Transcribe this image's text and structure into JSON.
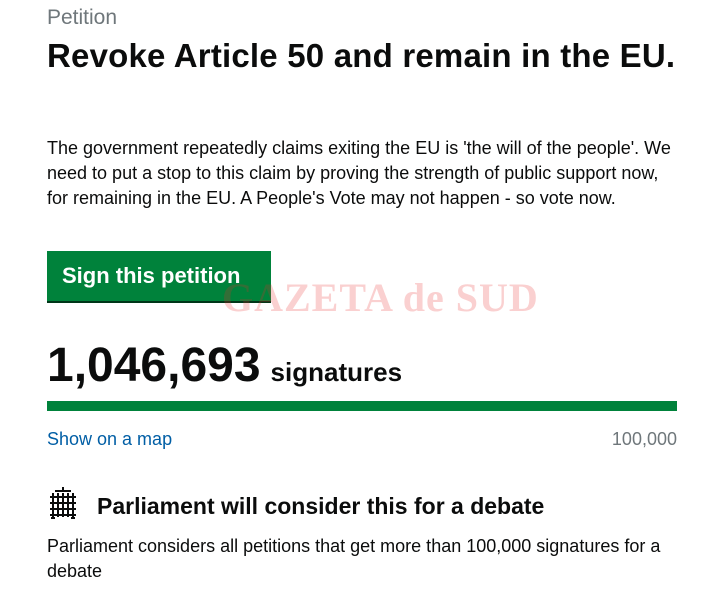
{
  "header": {
    "kicker": "Petition",
    "title": "Revoke Article 50 and remain in the EU."
  },
  "summary": "The government repeatedly claims exiting the EU is 'the will of the people'. We need to put a stop to this claim by proving the strength of public support now, for remaining in the EU. A People's Vote may not happen - so vote now.",
  "sign_button_label": "Sign this petition",
  "watermark": "GAZETA de SUD",
  "signatures": {
    "count": "1,046,693",
    "label": "signatures",
    "progress_fraction": 1.0,
    "map_link": "Show on a map",
    "threshold": "100,000"
  },
  "debate": {
    "icon": "portcullis-icon",
    "heading": "Parliament will consider this for a debate",
    "text": "Parliament considers all petitions that get more than 100,000 signatures for a debate"
  },
  "colors": {
    "button": "#00823b",
    "progress": "#00823b",
    "link": "#005ea5",
    "muted": "#6f777b"
  }
}
